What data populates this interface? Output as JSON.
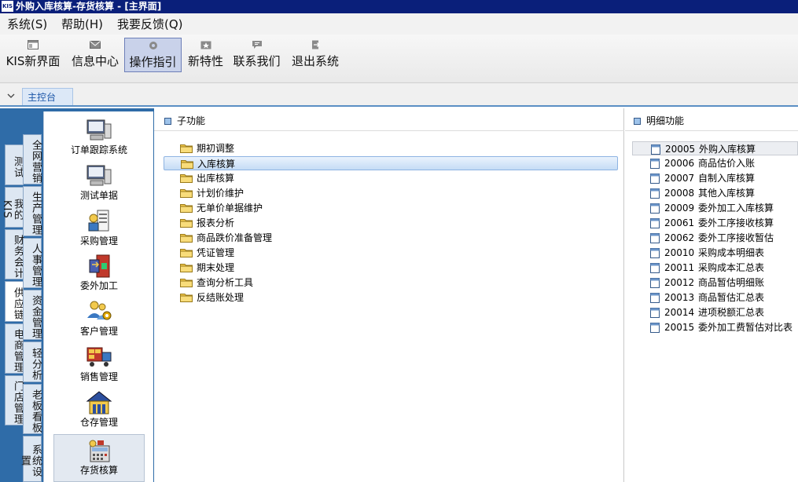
{
  "window": {
    "app_icon_text": "KIS",
    "title": "外购入库核算-存货核算 - [主界面]"
  },
  "menubar": [
    "系统(S)",
    "帮助(H)",
    "我要反馈(Q)"
  ],
  "toolbar": [
    {
      "label": "KIS新界面",
      "icon": "window-icon"
    },
    {
      "label": "信息中心",
      "icon": "envelope-icon"
    },
    {
      "label": "操作指引",
      "icon": "gear-icon",
      "active": true
    },
    {
      "label": "新特性",
      "icon": "star-icon"
    },
    {
      "label": "联系我们",
      "icon": "chat-icon"
    },
    {
      "label": "退出系统",
      "icon": "exit-icon"
    }
  ],
  "tabstrip": {
    "tab_label": "主控台"
  },
  "categories": {
    "outer": [
      "测试",
      "我的KIS",
      "财务会计",
      "供应链",
      "电商管理",
      "门店管理"
    ],
    "outer_active": "供应链",
    "inner": [
      "全网营销",
      "生产管理",
      "人事管理",
      "资金管理",
      "轻分析",
      "老板看板",
      "系统设置"
    ]
  },
  "functions": [
    {
      "label": "订单跟踪系统",
      "icon": "monitor-icon"
    },
    {
      "label": "测试单据",
      "icon": "monitor-icon"
    },
    {
      "label": "采购管理",
      "icon": "purchase-icon"
    },
    {
      "label": "委外加工",
      "icon": "door-icon"
    },
    {
      "label": "客户管理",
      "icon": "customers-icon"
    },
    {
      "label": "销售管理",
      "icon": "truck-icon"
    },
    {
      "label": "仓存管理",
      "icon": "warehouse-icon"
    },
    {
      "label": "存货核算",
      "icon": "calculator-icon",
      "active": true
    }
  ],
  "subpanel": {
    "header": "子功能",
    "selected_index": 1,
    "items": [
      "期初调整",
      "入库核算",
      "出库核算",
      "计划价维护",
      "无单价单据维护",
      "报表分析",
      "商品跌价准备管理",
      "凭证管理",
      "期末处理",
      "查询分析工具",
      "反结账处理"
    ]
  },
  "detailpanel": {
    "header": "明细功能",
    "selected_index": 0,
    "items": [
      {
        "code": "20005",
        "label": "外购入库核算"
      },
      {
        "code": "20006",
        "label": "商品估价入账"
      },
      {
        "code": "20007",
        "label": "自制入库核算"
      },
      {
        "code": "20008",
        "label": "其他入库核算"
      },
      {
        "code": "20009",
        "label": "委外加工入库核算"
      },
      {
        "code": "20061",
        "label": "委外工序接收核算"
      },
      {
        "code": "20062",
        "label": "委外工序接收暂估"
      },
      {
        "code": "20010",
        "label": "采购成本明细表"
      },
      {
        "code": "20011",
        "label": "采购成本汇总表"
      },
      {
        "code": "20012",
        "label": "商品暂估明细账"
      },
      {
        "code": "20013",
        "label": "商品暂估汇总表"
      },
      {
        "code": "20014",
        "label": "进项税额汇总表"
      },
      {
        "code": "20015",
        "label": "委外加工费暂估对比表"
      }
    ]
  },
  "colors": {
    "titlebar": "#0a1f7a",
    "frame_blue": "#2f6ca8",
    "selection": "#c5dcf5",
    "folder": "#f2c94c"
  }
}
